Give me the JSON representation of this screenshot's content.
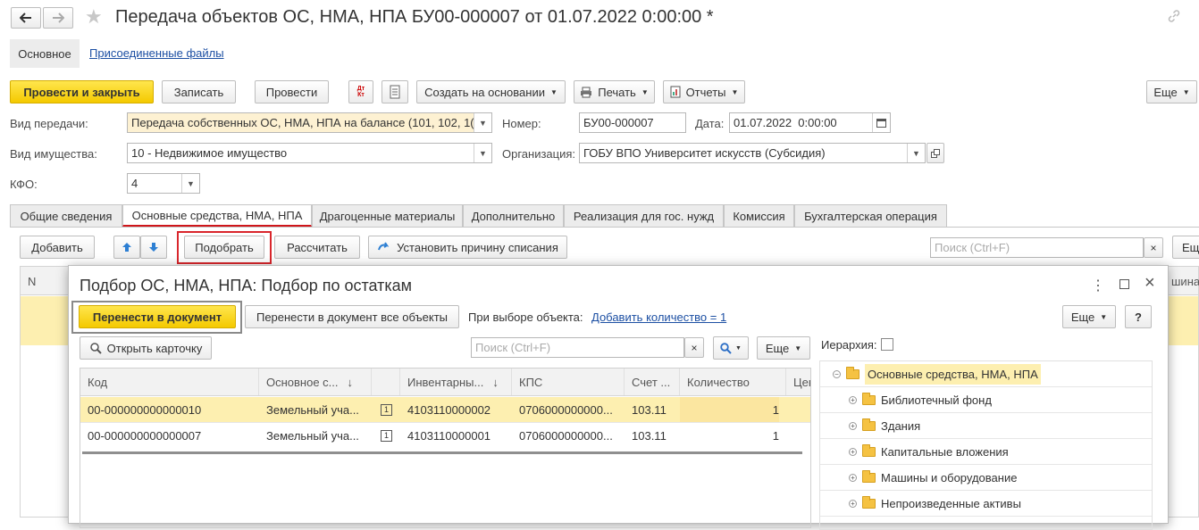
{
  "window": {
    "title": "Передача объектов ОС, НМА, НПА БУ00-000007 от 01.07.2022 0:00:00 *"
  },
  "nav": {
    "main_label": "Основное",
    "files_label": "Присоединенные файлы"
  },
  "toolbar": {
    "post_close": "Провести и закрыть",
    "save": "Записать",
    "post": "Провести",
    "dtkt_icon_text": "Дт Кт",
    "create_based": "Создать на основании",
    "print": "Печать",
    "reports": "Отчеты",
    "more": "Еще"
  },
  "form": {
    "transfer_type_label": "Вид передачи:",
    "transfer_type_value": "Передача собственных ОС, НМА, НПА на балансе (101, 102, 1(",
    "number_label": "Номер:",
    "number_value": "БУ00-000007",
    "date_label": "Дата:",
    "date_value": "01.07.2022  0:00:00",
    "property_type_label": "Вид имущества:",
    "property_type_value": "10 - Недвижимое имущество",
    "org_label": "Организация:",
    "org_value": "ГОБУ ВПО Университет искусств (Субсидия)",
    "kfo_label": "КФО:",
    "kfo_value": "4"
  },
  "tabs": [
    {
      "label": "Общие сведения"
    },
    {
      "label": "Основные средства, НМА, НПА"
    },
    {
      "label": "Драгоценные материалы"
    },
    {
      "label": "Дополнительно"
    },
    {
      "label": "Реализация для гос. нужд"
    },
    {
      "label": "Комиссия"
    },
    {
      "label": "Бухгалтерская операция"
    }
  ],
  "subtoolbar": {
    "add": "Добавить",
    "pick": "Подобрать",
    "calc": "Рассчитать",
    "set_reason": "Установить причину списания",
    "search_placeholder": "Поиск (Ctrl+F)",
    "more_cut": "Ещ"
  },
  "bg_table": {
    "col_n": "N",
    "col_right": "шина о"
  },
  "dialog": {
    "title": "Подбор ОС, НМА, НПА: Подбор по остаткам",
    "transfer_btn": "Перенести в документ",
    "transfer_all_btn": "Перенести в документ все объекты",
    "on_select_label": "При выборе объекта:",
    "add_qty_link": "Добавить количество = 1",
    "more": "Еще",
    "help": "?",
    "open_card": "Открыть карточку",
    "search_placeholder": "Поиск (Ctrl+F)",
    "hierarchy_label": "Иерархия:",
    "columns": [
      "Код",
      "Основное с...",
      "",
      "Инвентарны...",
      "КПС",
      "Счет ...",
      "Количество",
      "Цен"
    ],
    "rows": [
      {
        "code": "00-000000000000010",
        "name": "Земельный уча...",
        "flag": "1",
        "inv": "4103110000002",
        "kps": "0706000000000...",
        "account": "103.11",
        "qty": "1"
      },
      {
        "code": "00-000000000000007",
        "name": "Земельный уча...",
        "flag": "1",
        "inv": "4103110000001",
        "kps": "0706000000000...",
        "account": "103.11",
        "qty": "1"
      }
    ],
    "tree": [
      {
        "label": "Основные средства, НМА, НПА",
        "level": 0
      },
      {
        "label": "Библиотечный фонд",
        "level": 1
      },
      {
        "label": "Здания",
        "level": 1
      },
      {
        "label": "Капитальные вложения",
        "level": 1
      },
      {
        "label": "Машины и оборудование",
        "level": 1
      },
      {
        "label": "Непроизведенные активы",
        "level": 1
      }
    ]
  },
  "colors": {
    "accent_yellow": "#f4c900",
    "highlight_row": "#fdefb0",
    "red_frame": "#d9262c",
    "link": "#1c4fa3"
  }
}
